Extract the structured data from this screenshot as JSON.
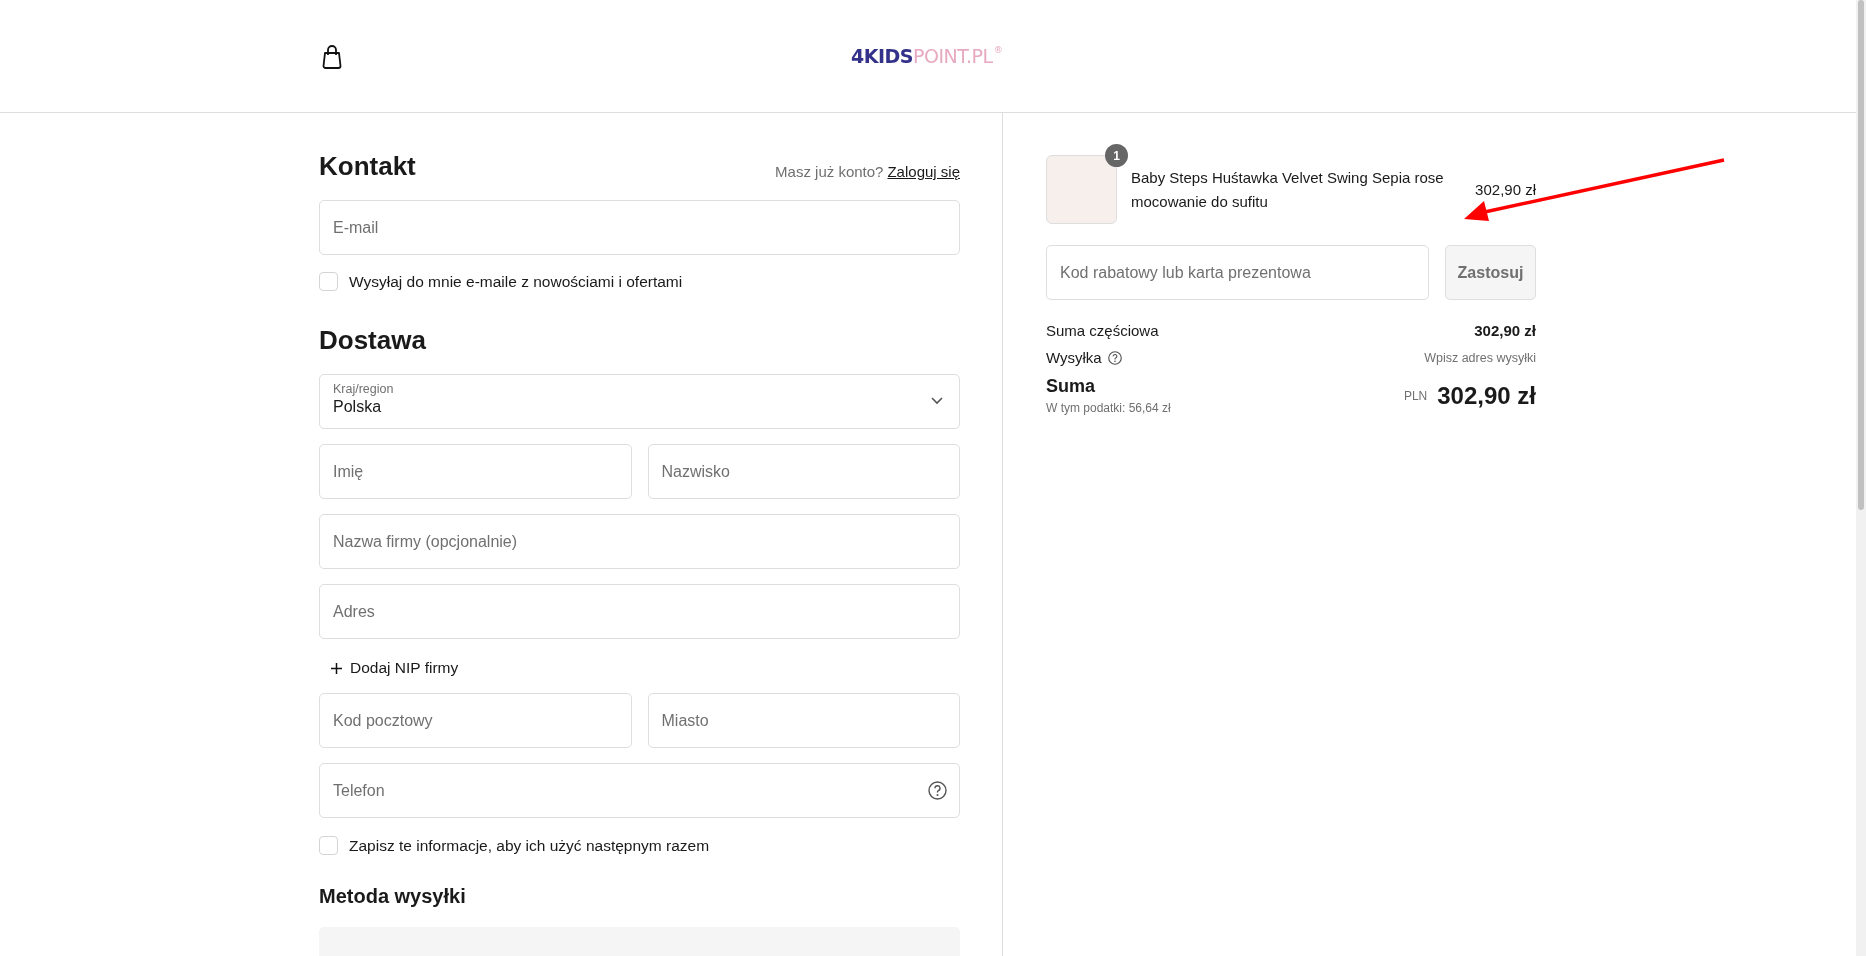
{
  "header": {
    "logo": {
      "primary": "4KIDS",
      "secondary": "POINT.PL",
      "mark": "®"
    }
  },
  "contact": {
    "heading": "Kontakt",
    "login_prompt": "Masz już konto?",
    "login_link": "Zaloguj się",
    "email": {
      "placeholder": "E-mail"
    },
    "newsletter": {
      "label": "Wysyłaj do mnie e-maile z nowościami i ofertami",
      "checked": false
    }
  },
  "delivery": {
    "heading": "Dostawa",
    "country": {
      "label": "Kraj/region",
      "value": "Polska"
    },
    "items": [
      {
        "kind": "row",
        "fields": [
          {
            "placeholder": "Imię"
          },
          {
            "placeholder": "Nazwisko"
          }
        ]
      },
      {
        "kind": "row",
        "fields": [
          {
            "placeholder": "Nazwa firmy (opcjonalnie)"
          }
        ]
      },
      {
        "kind": "row",
        "fields": [
          {
            "placeholder": "Adres"
          }
        ]
      },
      {
        "kind": "link",
        "label": "Dodaj NIP firmy"
      },
      {
        "kind": "row",
        "fields": [
          {
            "placeholder": "Kod pocztowy"
          },
          {
            "placeholder": "Miasto"
          }
        ]
      },
      {
        "kind": "phone",
        "placeholder": "Telefon"
      },
      {
        "kind": "checkbox",
        "label": "Zapisz te informacje, aby ich użyć następnym razem",
        "checked": false
      }
    ]
  },
  "shipping_method": {
    "heading": "Metoda wysyłki"
  },
  "summary": {
    "product": {
      "quantity": "1",
      "title": "Baby Steps Huśtawka Velvet Swing Sepia rose mocowanie do sufitu",
      "price": "302,90 zł"
    },
    "discount": {
      "placeholder": "Kod rabatowy lub karta prezentowa",
      "button": "Zastosuj"
    },
    "lines": [
      {
        "kind": "subtotal",
        "label": "Suma częściowa",
        "value": "302,90 zł"
      },
      {
        "kind": "shipping",
        "label": "Wysyłka",
        "value": "Wpisz adres wysyłki"
      }
    ],
    "total": {
      "label": "Suma",
      "tax_note": "W tym podatki: 56,64 zł",
      "currency": "PLN",
      "amount": "302,90 zł"
    }
  }
}
